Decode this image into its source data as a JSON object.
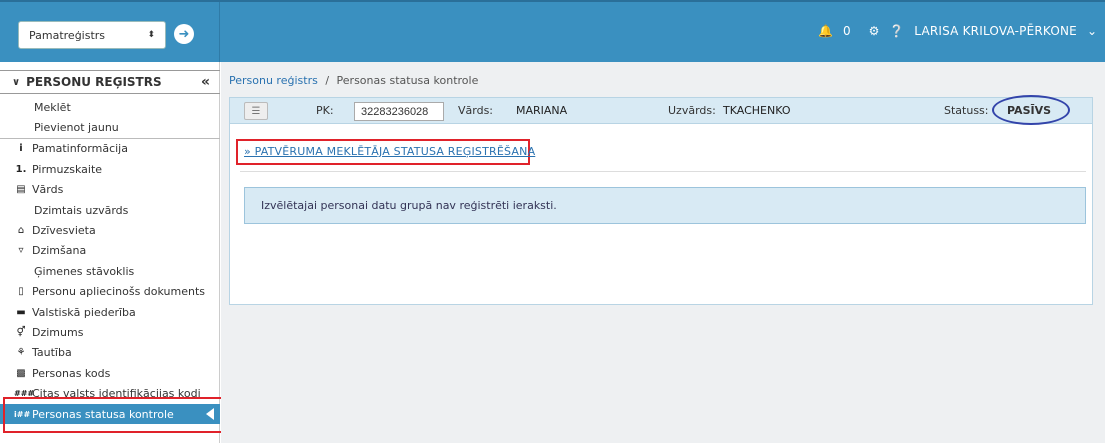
{
  "topbar": {
    "select_value": "Pamatreģistrs",
    "notifications_count": "0",
    "user_name": "LARISA KRILOVA-PĒRKONE"
  },
  "sidebar": {
    "header": "PERSONU REĢISTRS",
    "items": [
      {
        "label": "Meklēt",
        "icon": "",
        "type": "sub"
      },
      {
        "label": "Pievienot jaunu",
        "icon": "",
        "type": "sub"
      },
      {
        "label": "Pamatinformācija",
        "icon": "info-icon",
        "type": "ico"
      },
      {
        "label": "Pirmuzskaite",
        "icon": "number-one-icon",
        "type": "ico"
      },
      {
        "label": "Vārds",
        "icon": "name-card-icon",
        "type": "ico"
      },
      {
        "label": "Dzimtais uzvārds",
        "icon": "",
        "type": "sub"
      },
      {
        "label": "Dzīvesvieta",
        "icon": "house-icon",
        "type": "ico"
      },
      {
        "label": "Dzimšana",
        "icon": "birth-icon",
        "type": "ico"
      },
      {
        "label": "Ģimenes stāvoklis",
        "icon": "",
        "type": "sub"
      },
      {
        "label": "Personu apliecinošs dokuments",
        "icon": "document-icon",
        "type": "ico"
      },
      {
        "label": "Valstiskā piederība",
        "icon": "flag-icon",
        "type": "ico"
      },
      {
        "label": "Dzimums",
        "icon": "gender-icon",
        "type": "ico"
      },
      {
        "label": "Tautība",
        "icon": "people-icon",
        "type": "ico"
      },
      {
        "label": "Personas kods",
        "icon": "id-code-icon",
        "type": "ico"
      },
      {
        "label": "Citas valsts identifikācijas kodi",
        "icon": "id-codes-icon",
        "type": "ico"
      },
      {
        "label": "Personas statusa kontrole",
        "icon": "status-control-icon",
        "type": "ico",
        "active": true
      }
    ]
  },
  "breadcrumb": {
    "link": "Personu reģistrs",
    "separator": "/",
    "current": "Personas statusa kontrole"
  },
  "person": {
    "pk_label": "PK:",
    "pk_value": "32283236028",
    "name_label": "Vārds:",
    "name_value": "MARIANA",
    "surname_label": "Uzvārds:",
    "surname_value": "TKACHENKO",
    "status_label": "Statuss:",
    "status_value": "PASĪVS"
  },
  "main": {
    "register_link": "» PATVĒRUMA MEKLĒTĀJA STATUSA REĢISTRĒŠANA",
    "info_text": "Izvēlētajai personai datu grupā nav reģistrēti ieraksti."
  },
  "colors": {
    "accent": "#3a90c0",
    "highlight_frame": "#e0222a",
    "status_ellipse": "#3344aa",
    "info_bg": "#d8eaf4"
  }
}
